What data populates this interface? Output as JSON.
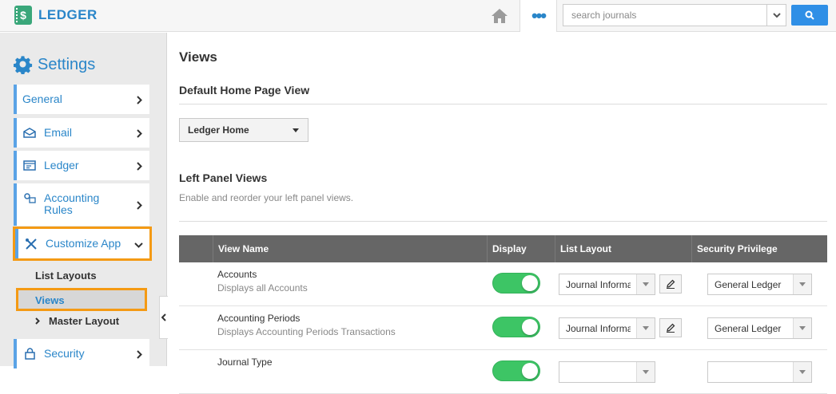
{
  "brand": {
    "name": "LEDGER",
    "icon_symbol": "$"
  },
  "header": {
    "search_placeholder": "search journals",
    "more_label": "•••"
  },
  "sidebar": {
    "title": "Settings",
    "items": [
      {
        "label": "General",
        "icon": ""
      },
      {
        "label": "Email",
        "icon": "envelope-icon"
      },
      {
        "label": "Ledger",
        "icon": "ledger-icon"
      },
      {
        "label": "Accounting Rules",
        "icon": "rules-icon"
      },
      {
        "label": "Customize App",
        "icon": "tools-icon"
      },
      {
        "label": "Security",
        "icon": "lock-icon"
      }
    ],
    "subitems": {
      "list_layouts": "List Layouts",
      "views": "Views",
      "master_layout": "Master Layout"
    }
  },
  "main": {
    "title": "Views",
    "default_home": {
      "heading": "Default Home Page View",
      "selected": "Ledger Home"
    },
    "left_panel": {
      "heading": "Left Panel Views",
      "hint": "Enable and reorder your left panel views.",
      "columns": [
        "View Name",
        "Display",
        "List Layout",
        "Security Privilege"
      ],
      "rows": [
        {
          "name": "Accounts",
          "desc": "Displays all Accounts",
          "display": true,
          "layout": "Journal Information",
          "privilege": "General Ledger"
        },
        {
          "name": "Accounting Periods",
          "desc": "Displays Accounting Periods Transactions",
          "display": true,
          "layout": "Journal Information",
          "privilege": "General Ledger"
        },
        {
          "name": "Journal Type",
          "desc": "",
          "display": true,
          "layout": "",
          "privilege": ""
        }
      ]
    }
  },
  "colors": {
    "accent": "#2a86c9",
    "highlight": "#f49a14",
    "toggle_on": "#3dc565",
    "table_header": "#666666"
  }
}
